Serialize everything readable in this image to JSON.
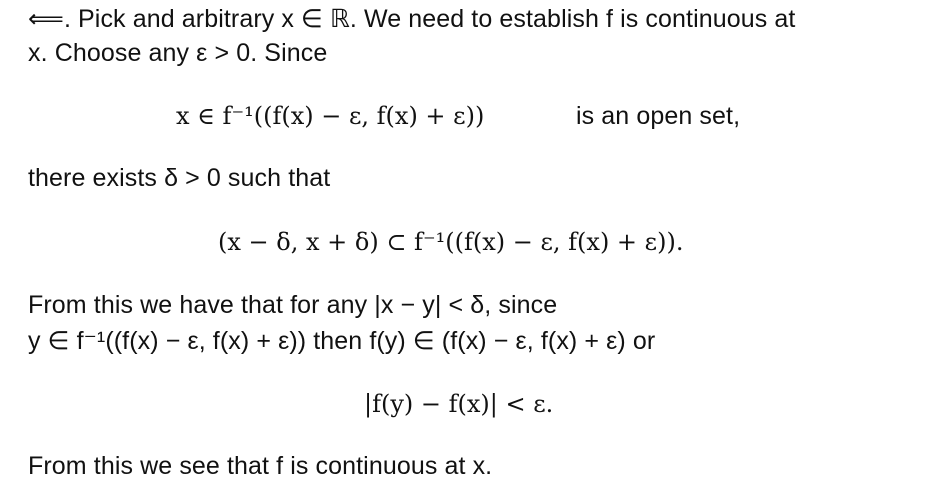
{
  "document": {
    "paragraph1_line1": "⟸. Pick and arbitrary x ∈ ℝ. We need to establish f is continuous at",
    "paragraph1_line2": "x. Choose any ε > 0. Since",
    "display1_math": "x ∈ f⁻¹((f(x) − ε, f(x) + ε))",
    "display1_text": "is an open set,",
    "paragraph2": "there exists δ > 0 such that",
    "display2": "(x − δ, x + δ) ⊂ f⁻¹((f(x) − ε, f(x) + ε)).",
    "paragraph3_line1": "From this we have that for any |x − y| < δ, since",
    "paragraph3_line2": "y ∈ f⁻¹((f(x) − ε, f(x) + ε)) then f(y) ∈ (f(x) − ε, f(x) + ε) or",
    "display3": "|f(y) − f(x)| < ε.",
    "paragraph4": "From this we see that f is continuous at x."
  }
}
